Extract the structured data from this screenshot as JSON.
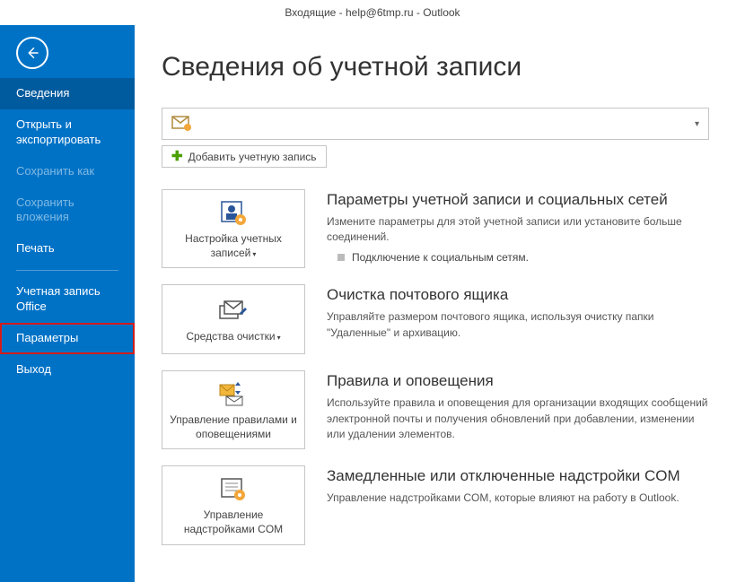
{
  "titlebar": "Входящие - help@6tmp.ru - Outlook",
  "sidebar": {
    "items": [
      {
        "label": "Сведения",
        "active": true
      },
      {
        "label": "Открыть и экспортировать"
      },
      {
        "label": "Сохранить как",
        "disabled": true
      },
      {
        "label": "Сохранить вложения",
        "disabled": true
      },
      {
        "label": "Печать"
      },
      {
        "label": "Учетная запись Office"
      },
      {
        "label": "Параметры",
        "highlighted": true
      },
      {
        "label": "Выход"
      }
    ]
  },
  "page": {
    "title": "Сведения об учетной записи",
    "add_account": "Добавить учетную запись"
  },
  "sections": [
    {
      "btn_label": "Настройка учетных записей",
      "has_dropdown": true,
      "heading": "Параметры учетной записи и социальных сетей",
      "desc": "Измените параметры для этой учетной записи или установите больше соединений.",
      "bullet": "Подключение к социальным сетям."
    },
    {
      "btn_label": "Средства очистки",
      "has_dropdown": true,
      "heading": "Очистка почтового ящика",
      "desc": "Управляйте размером почтового ящика, используя очистку папки \"Удаленные\" и архивацию."
    },
    {
      "btn_label": "Управление правилами и оповещениями",
      "heading": "Правила и оповещения",
      "desc": "Используйте правила и оповещения для организации входящих сообщений электронной почты и получения обновлений при добавлении, изменении или удалении элементов."
    },
    {
      "btn_label": "Управление надстройками COM",
      "heading": "Замедленные или отключенные надстройки COM",
      "desc": "Управление надстройками COM, которые влияют на работу в Outlook."
    }
  ]
}
